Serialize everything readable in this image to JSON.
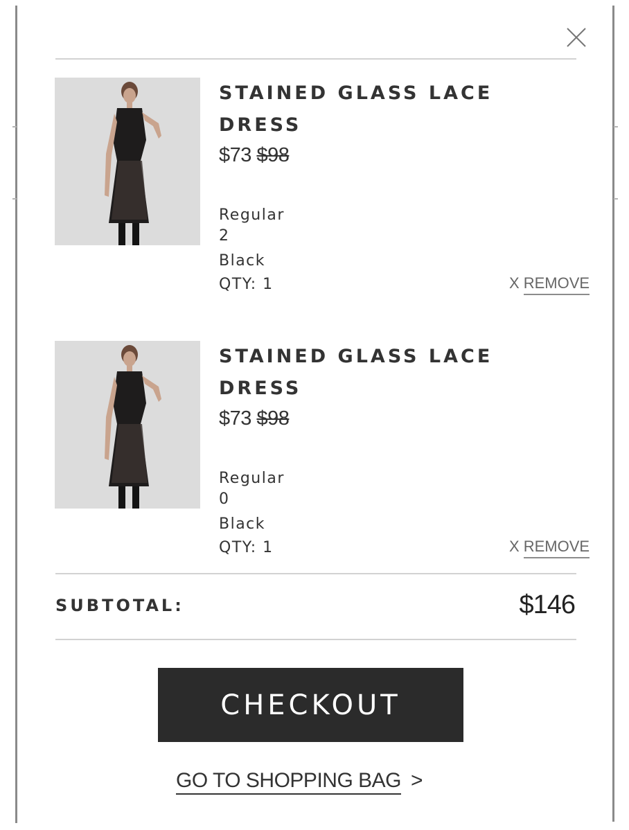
{
  "cart": {
    "close_icon": "close-icon",
    "items": [
      {
        "name": "STAINED GLASS LACE DRESS",
        "sale_price": "$73",
        "original_price": "$98",
        "fit": "Regular",
        "size": "2",
        "color": "Black",
        "qty": "QTY: 1",
        "remove_x": "X",
        "remove_label": "REMOVE"
      },
      {
        "name": "STAINED GLASS LACE DRESS",
        "sale_price": "$73",
        "original_price": "$98",
        "fit": "Regular",
        "size": "0",
        "color": "Black",
        "qty": "QTY: 1",
        "remove_x": "X",
        "remove_label": "REMOVE"
      }
    ],
    "subtotal_label": "SUBTOTAL:",
    "subtotal_value": "$146",
    "checkout_label": "CHECKOUT",
    "bag_link_label": "GO TO SHOPPING BAG",
    "bag_link_chevron": ">"
  },
  "colors": {
    "checkout_bg": "#2b2b2b",
    "text": "#333333",
    "divider": "#d2d2d2"
  }
}
